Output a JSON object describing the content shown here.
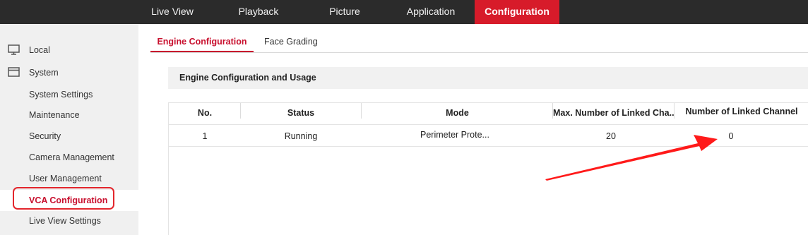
{
  "topnav": {
    "items": [
      {
        "label": "Live View"
      },
      {
        "label": "Playback"
      },
      {
        "label": "Picture"
      },
      {
        "label": "Application"
      },
      {
        "label": "Configuration"
      }
    ],
    "active_color": "#d71b2a"
  },
  "sidebar": {
    "items": [
      {
        "label": "Local",
        "icon": "monitor-icon"
      },
      {
        "label": "System",
        "icon": "system-window-icon"
      },
      {
        "label": "System Settings"
      },
      {
        "label": "Maintenance"
      },
      {
        "label": "Security"
      },
      {
        "label": "Camera Management"
      },
      {
        "label": "User Management"
      },
      {
        "label": "VCA Configuration",
        "active": true
      },
      {
        "label": "Live View Settings"
      }
    ]
  },
  "tabs": [
    {
      "label": "Engine Configuration",
      "active": true
    },
    {
      "label": "Face Grading"
    }
  ],
  "section": {
    "title": "Engine Configuration and Usage"
  },
  "table": {
    "headers": [
      "No.",
      "Status",
      "Mode",
      "Max. Number of Linked Cha...",
      "Number of Linked Channel"
    ],
    "rows": [
      [
        "1",
        "Running",
        "Perimeter Prote...",
        "20",
        "0"
      ]
    ]
  },
  "annotation": {
    "arrow_color": "#ff1a1a",
    "highlight": "VCA Configuration"
  }
}
